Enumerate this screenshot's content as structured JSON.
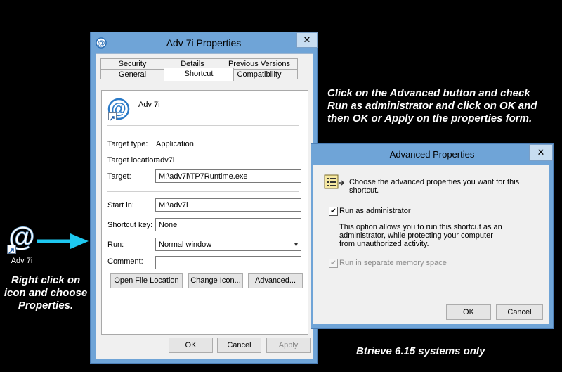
{
  "desktop": {
    "icon_label": "Adv 7i",
    "instruction_left": "Right click on icon and choose Properties.",
    "instruction_right": "Click on the Advanced button and check Run as administrator and click on OK and then OK or Apply on the properties form.",
    "footnote": "Btrieve 6.15 systems only"
  },
  "properties_window": {
    "title": "Adv 7i Properties",
    "close_glyph": "✕",
    "tabs_row1": [
      "Security",
      "Details",
      "Previous Versions"
    ],
    "tabs_row2": [
      "General",
      "Shortcut",
      "Compatibility"
    ],
    "active_tab": "Shortcut",
    "shortcut_name": "Adv 7i",
    "target_type_label": "Target type:",
    "target_type_value": "Application",
    "target_location_label": "Target location:",
    "target_location_value": "adv7i",
    "target_label": "Target:",
    "target_value": "M:\\adv7i\\TP7Runtime.exe",
    "start_in_label": "Start in:",
    "start_in_value": "M:\\adv7i",
    "shortcut_key_label": "Shortcut key:",
    "shortcut_key_value": "None",
    "run_label": "Run:",
    "run_value": "Normal window",
    "comment_label": "Comment:",
    "comment_value": "",
    "open_file_location_button": "Open File Location",
    "change_icon_button": "Change Icon...",
    "advanced_button": "Advanced...",
    "ok_button": "OK",
    "cancel_button": "Cancel",
    "apply_button": "Apply"
  },
  "advanced_dialog": {
    "title": "Advanced Properties",
    "close_glyph": "✕",
    "prompt": "Choose the advanced properties you want for this shortcut.",
    "run_as_admin_label": "Run as administrator",
    "run_as_admin_checked": true,
    "description": "This option allows you to run this shortcut as an administrator, while protecting your computer from unauthorized activity.",
    "separate_memory_label": "Run in separate memory space",
    "separate_memory_checked": true,
    "ok_button": "OK",
    "cancel_button": "Cancel"
  },
  "colors": {
    "background": "#000000",
    "window_frame": "#6fa4d7",
    "callout_arrow": "#1ec8f0"
  }
}
